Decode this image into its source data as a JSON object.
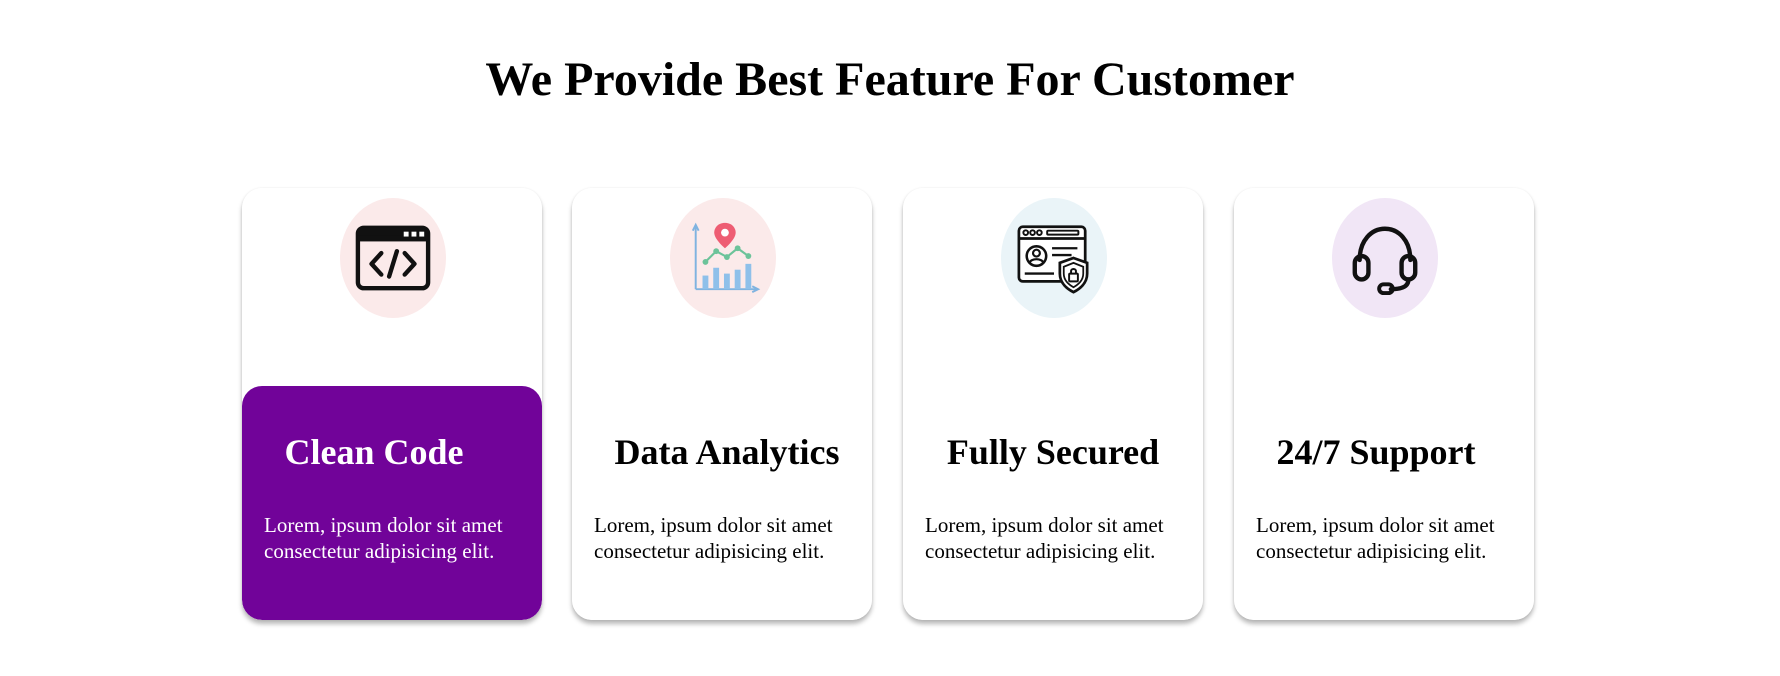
{
  "page": {
    "title": "We Provide Best Feature For Customer"
  },
  "colors": {
    "accent": "#710399",
    "circle_pink": "#fbeaea",
    "circle_blue": "#eaf4f8",
    "circle_purple": "#f1e6f6"
  },
  "features": [
    {
      "title": "Clean Code",
      "text": "Lorem, ipsum dolor sit amet consectetur adipisicing elit.",
      "icon": "code-window-icon",
      "active": true
    },
    {
      "title": "Data Analytics",
      "text": "Lorem, ipsum dolor sit amet consectetur adipisicing elit.",
      "icon": "analytics-chart-icon",
      "active": false
    },
    {
      "title": "Fully Secured",
      "text": "Lorem, ipsum dolor sit amet consectetur adipisicing elit.",
      "icon": "secure-profile-icon",
      "active": false
    },
    {
      "title": "24/7 Support",
      "text": "Lorem, ipsum dolor sit amet consectetur adipisicing elit.",
      "icon": "headset-icon",
      "active": false
    }
  ]
}
